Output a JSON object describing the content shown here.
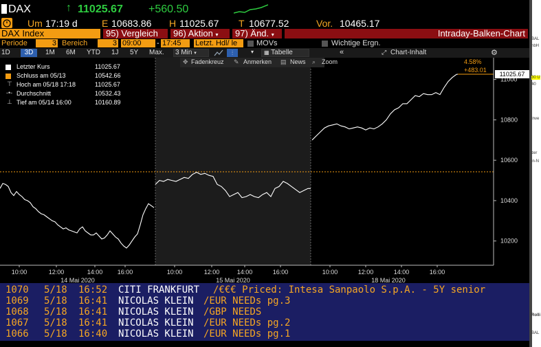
{
  "header": {
    "ticker": "DAX",
    "price": "11025.67",
    "change": "+560.50",
    "time_label": "Um",
    "time": "17:19 d",
    "e_label": "E",
    "e_value": "10683.86",
    "h_label": "H",
    "h_value": "11025.67",
    "t_label": "T",
    "t_value": "10677.52",
    "vor_label": "Vor.",
    "vor_value": "10465.17"
  },
  "toolbar": {
    "index_name": "DAX Index",
    "vergleich": "95) Vergleich",
    "aktion": "96) Aktion",
    "aend": "97) Änd.",
    "chart_title": "Intraday-Balken-Chart"
  },
  "period": {
    "periode_label": "Periode",
    "periode_value": "3",
    "bereich_label": "Bereich",
    "bereich_value": "3",
    "time_from": "09:00",
    "time_to": "17:45",
    "letzt": "Letzt. Hdl/ le",
    "movs": "MOVs",
    "wichtige": "Wichtige Ergn."
  },
  "ranges": {
    "items": [
      "1D",
      "3D",
      "1M",
      "6M",
      "YTD",
      "1J",
      "5Y",
      "Max."
    ],
    "active": "3D",
    "interval": "3 Min",
    "tabelle": "Tabelle",
    "chart_inhalt": "Chart-Inhalt"
  },
  "tools": {
    "fadenkreuz": "Fadenkreuz",
    "anmerken": "Anmerken",
    "news": "News",
    "zoom": "Zoom"
  },
  "legend": {
    "items": [
      {
        "label": "Letzter Kurs",
        "value": "11025.67"
      },
      {
        "label": "Schluss am 05/13",
        "value": "10542.66"
      },
      {
        "label": "Hoch am 05/18 17:18",
        "value": "11025.67"
      },
      {
        "label": "Durchschnitt",
        "value": "10532.43"
      },
      {
        "label": "Tief am 05/14 16:00",
        "value": "10160.89"
      }
    ]
  },
  "price_labels": {
    "pct": "4.58%",
    "abs": "+483.01",
    "last": "11025.67"
  },
  "chart_data": {
    "type": "line",
    "title": "",
    "xlabel": "",
    "ylabel": "",
    "ylim": [
      10080,
      11060
    ],
    "yticks": [
      10200,
      10400,
      10600,
      10800,
      11000
    ],
    "xticks": [
      "10:00",
      "12:00",
      "14:00",
      "16:00",
      "10:00",
      "12:00",
      "14:00",
      "16:00",
      "10:00",
      "12:00",
      "14:00",
      "16:00"
    ],
    "day_labels": [
      "14 Mai 2020",
      "15 Mai 2020",
      "18 Mai 2020"
    ],
    "reference_line": 10542.66,
    "series": [
      {
        "x": [
          0,
          4,
          8,
          12,
          16,
          20,
          24,
          28,
          32,
          36,
          40,
          44,
          48,
          52,
          56,
          60,
          64,
          68,
          72,
          76,
          80,
          84,
          88,
          92,
          96,
          100,
          104,
          108,
          112,
          116,
          120,
          124,
          128,
          132,
          136,
          140,
          144,
          148,
          152,
          156,
          160,
          164,
          168,
          172,
          176,
          180,
          184,
          188,
          192,
          196,
          200,
          204,
          208,
          212,
          216,
          220,
          224
        ],
        "values": [
          10460,
          10485,
          10480,
          10470,
          10440,
          10425,
          10445,
          10430,
          10420,
          10405,
          10400,
          10390,
          10370,
          10360,
          10345,
          10335,
          10330,
          10320,
          10310,
          10300,
          10295,
          10280,
          10270,
          10260,
          10265,
          10255,
          10250,
          10245,
          10240,
          10260,
          10270,
          10250,
          10240,
          10230,
          10230,
          10240,
          10225,
          10210,
          10215,
          10230,
          10250,
          10235,
          10220,
          10210,
          10190,
          10175,
          10165,
          10180,
          10200,
          10220,
          10235,
          10280,
          10330,
          10360,
          10385,
          10375,
          10365
        ]
      },
      {
        "x": [
          226,
          232,
          238,
          244,
          250,
          256,
          262,
          268,
          274,
          280,
          286,
          292,
          298,
          304,
          310,
          316,
          322,
          328,
          334,
          340,
          346,
          352,
          358,
          364,
          370,
          376,
          382,
          388,
          394,
          400,
          406,
          412,
          418,
          424,
          430,
          436,
          442,
          448,
          452
        ],
        "values": [
          10480,
          10500,
          10495,
          10505,
          10500,
          10495,
          10505,
          10515,
          10510,
          10530,
          10540,
          10530,
          10535,
          10525,
          10520,
          10480,
          10470,
          10450,
          10420,
          10430,
          10440,
          10415,
          10420,
          10430,
          10420,
          10415,
          10430,
          10440,
          10420,
          10460,
          10470,
          10495,
          10485,
          10470,
          10455,
          10440,
          10450,
          10460,
          10460
        ]
      },
      {
        "x": [
          454,
          460,
          466,
          472,
          478,
          484,
          490,
          496,
          502,
          508,
          514,
          520,
          526,
          532,
          538,
          544,
          550,
          556,
          562,
          568,
          574,
          580,
          586,
          592,
          598,
          604,
          610,
          616,
          622,
          628,
          634,
          640,
          646,
          652,
          658,
          664,
          666
        ],
        "values": [
          10700,
          10720,
          10740,
          10760,
          10770,
          10775,
          10780,
          10770,
          10765,
          10755,
          10760,
          10765,
          10760,
          10750,
          10760,
          10755,
          10765,
          10780,
          10800,
          10830,
          10850,
          10860,
          10880,
          10880,
          10900,
          10920,
          10915,
          10930,
          10925,
          10925,
          10935,
          10925,
          10960,
          10990,
          11010,
          11025,
          11026
        ]
      }
    ]
  },
  "news": {
    "items": [
      {
        "id": "1070",
        "date": "5/18",
        "time": "16:52",
        "source": "CITI FRANKFURT",
        "headline": "/€€€ Priced: Intesa Sanpaolo S.p.A. - 5Y senior"
      },
      {
        "id": "1069",
        "date": "5/18",
        "time": "16:41",
        "source": "NICOLAS KLEIN",
        "headline": "/EUR NEEDs pg.3"
      },
      {
        "id": "1068",
        "date": "5/18",
        "time": "16:41",
        "source": "NICOLAS KLEIN",
        "headline": "/GBP NEEDS"
      },
      {
        "id": "1067",
        "date": "5/18",
        "time": "16:41",
        "source": "NICOLAS KLEIN",
        "headline": "/EUR NEEDs pg.2"
      },
      {
        "id": "1066",
        "date": "5/18",
        "time": "16:40",
        "source": "NICOLAS KLEIN",
        "headline": "/EUR NEEDs pg.1"
      }
    ]
  },
  "right_strip": {
    "lines": [
      "BAL",
      "nbH",
      "30 U",
      "40",
      "Inve",
      "zer",
      "in-N",
      "Rolli",
      "BAL"
    ]
  },
  "colors": {
    "accent_orange": "#f39c12",
    "up_green": "#2ecc40",
    "news_bg": "#1b1e63",
    "ref_line": "#f39c12"
  }
}
